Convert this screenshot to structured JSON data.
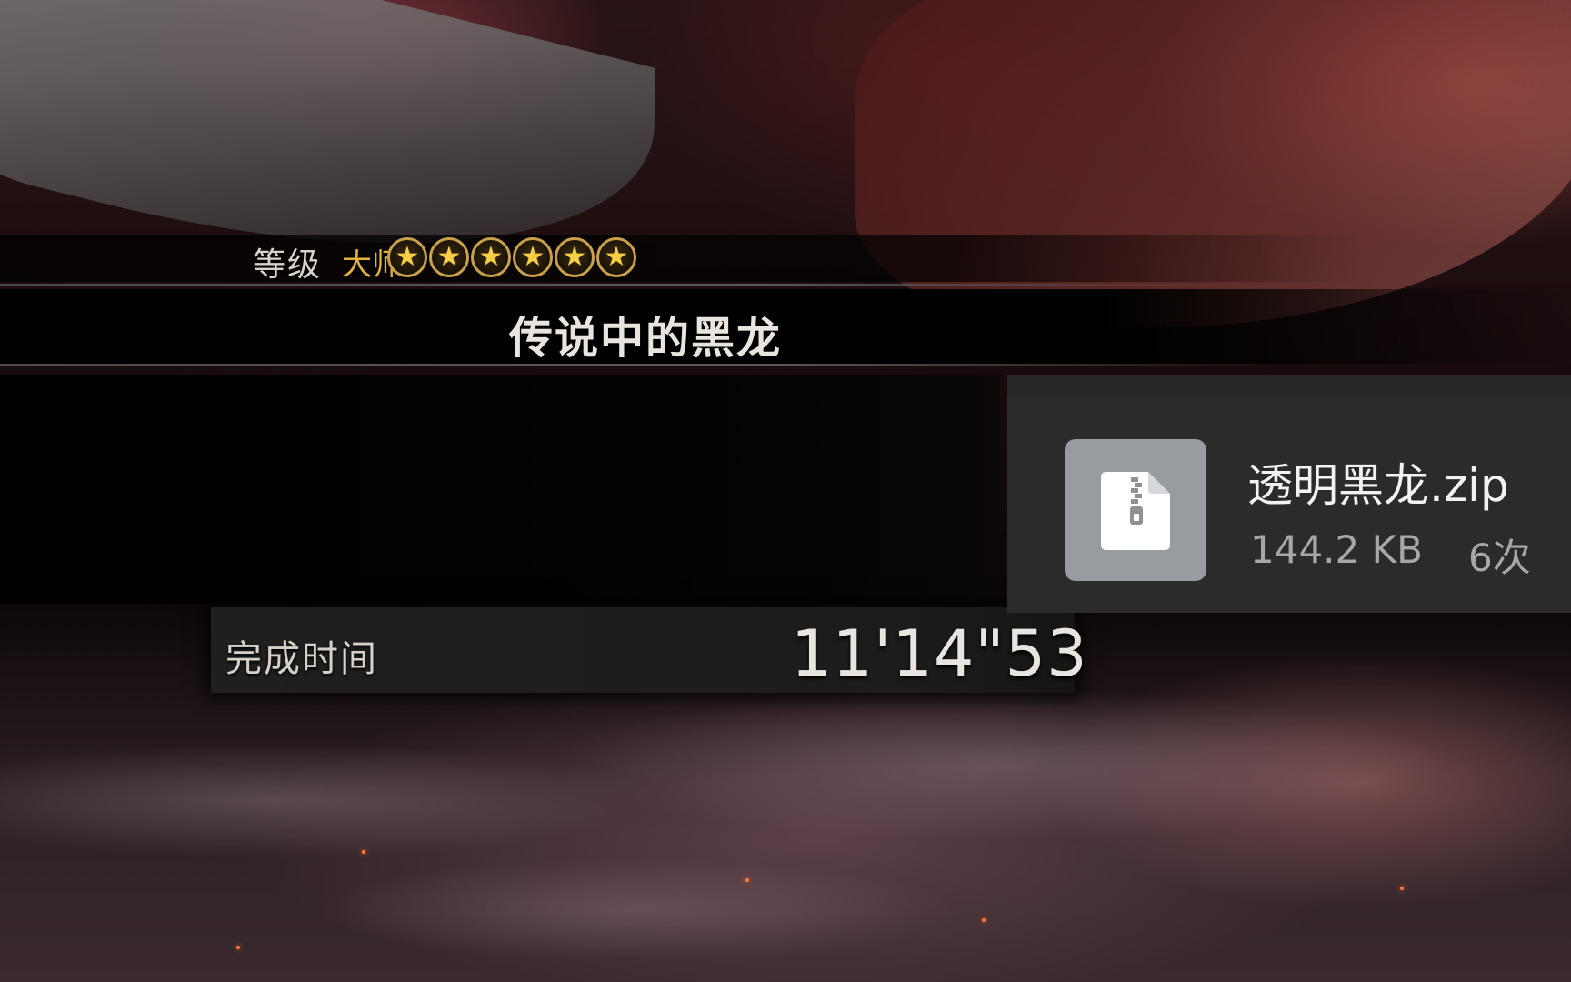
{
  "result_screen": {
    "rank_label": "等级",
    "rank_title": "大师",
    "stars": [
      "★",
      "★",
      "★",
      "★",
      "★",
      "★"
    ],
    "star_count": 6,
    "quest_title": "传说中的黑龙",
    "completion_time_label": "完成时间",
    "completion_time_value": "11'14\"53"
  },
  "file_card": {
    "icon": "zip-file-icon",
    "file_name": "透明黑龙.zip",
    "file_size": "144.2 KB",
    "download_count": "6次"
  }
}
